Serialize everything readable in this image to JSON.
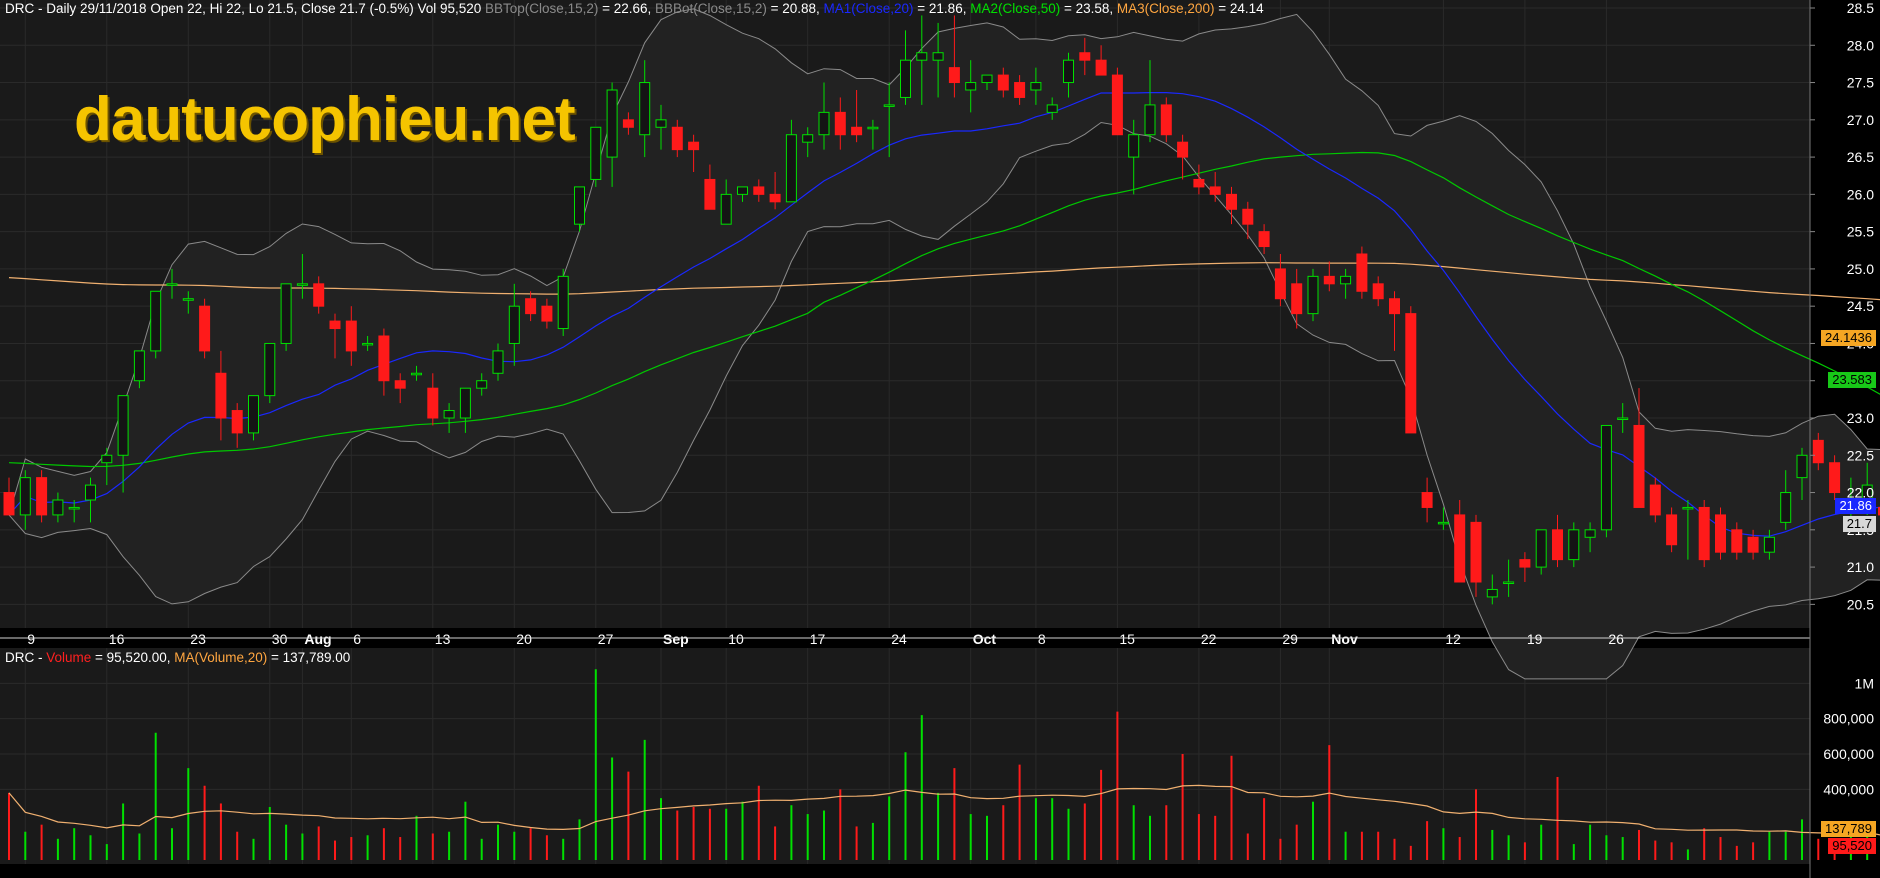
{
  "header": {
    "title": "DRC - Daily 29/11/2018 Open 22, Hi 22, Lo 21.5, Close 21.7 (-0.5%) Vol 95,520 ",
    "bbtop_label": "BBTop(Close,15,2)",
    "bbtop_value": " = 22.66, ",
    "bbbot_label": "BBBot(Close,15,2)",
    "bbbot_value": " = 20.88, ",
    "ma1_label": "MA1(Close,20)",
    "ma1_value": " = 21.86, ",
    "ma2_label": "MA2(Close,50)",
    "ma2_value": " = 23.58, ",
    "ma3_label": "MA3(Close,200)",
    "ma3_value": " = 24.14"
  },
  "volume_header": {
    "prefix": "DRC - ",
    "vol_label": "Volume",
    "vol_value": " = 95,520.00, ",
    "ma_label": "MA(Volume,20)",
    "ma_value": " = 137,789.00"
  },
  "watermark": "dautucophieu.net",
  "price_tags": {
    "ma3": "24.1436",
    "ma2": "23.583",
    "ma1": "21.86",
    "close": "21.7"
  },
  "volume_tags": {
    "ma": "137,789",
    "vol": "95,520"
  },
  "colors": {
    "background": "#000000",
    "up": "#00e000",
    "down": "#ff1a1a",
    "bollinger": "#8a8a8a",
    "ma1": "#1a28ff",
    "ma2": "#00c800",
    "ma3": "#f0b070",
    "grid": "#2a2a2a",
    "band_fill": "#222222"
  },
  "chart_data": {
    "type": "candlestick",
    "ticker": "DRC",
    "price_axis": {
      "min": 20.25,
      "max": 28.5,
      "ticks": [
        "20.5",
        "21.0",
        "21.5",
        "22.0",
        "22.5",
        "23.0",
        "23.5",
        "24.0",
        "24.5",
        "25.0",
        "25.5",
        "26.0",
        "26.5",
        "27.0",
        "27.5",
        "28.0",
        "28.5"
      ]
    },
    "volume_axis": {
      "min": 0,
      "max": 1200000,
      "ticks": [
        "400,000",
        "600,000",
        "800,000",
        "1M"
      ],
      "tick_values": [
        400000,
        600000,
        800000,
        1000000
      ]
    },
    "x_labels": [
      {
        "i": 1,
        "t": "9"
      },
      {
        "i": 6,
        "t": "16"
      },
      {
        "i": 11,
        "t": "23"
      },
      {
        "i": 16,
        "t": "30"
      },
      {
        "i": 18,
        "t": "Aug"
      },
      {
        "i": 21,
        "t": "6"
      },
      {
        "i": 26,
        "t": "13"
      },
      {
        "i": 31,
        "t": "20"
      },
      {
        "i": 36,
        "t": "27"
      },
      {
        "i": 40,
        "t": "Sep"
      },
      {
        "i": 44,
        "t": "10"
      },
      {
        "i": 49,
        "t": "17"
      },
      {
        "i": 54,
        "t": "24"
      },
      {
        "i": 59,
        "t": "Oct"
      },
      {
        "i": 63,
        "t": "8"
      },
      {
        "i": 68,
        "t": "15"
      },
      {
        "i": 73,
        "t": "22"
      },
      {
        "i": 78,
        "t": "29"
      },
      {
        "i": 81,
        "t": "Nov"
      },
      {
        "i": 88,
        "t": "12"
      },
      {
        "i": 93,
        "t": "19"
      },
      {
        "i": 98,
        "t": "26"
      }
    ],
    "ohlc": [
      [
        22.0,
        22.2,
        21.7,
        21.7
      ],
      [
        21.7,
        22.3,
        21.5,
        22.2
      ],
      [
        22.2,
        22.3,
        21.6,
        21.7
      ],
      [
        21.7,
        22.0,
        21.6,
        21.9
      ],
      [
        21.8,
        21.9,
        21.6,
        21.8
      ],
      [
        21.9,
        22.2,
        21.6,
        22.1
      ],
      [
        22.4,
        22.6,
        22.1,
        22.5
      ],
      [
        22.5,
        23.3,
        22.0,
        23.3
      ],
      [
        23.5,
        23.9,
        23.4,
        23.9
      ],
      [
        23.9,
        24.7,
        23.8,
        24.7
      ],
      [
        24.8,
        25.0,
        24.6,
        24.8
      ],
      [
        24.6,
        24.7,
        24.4,
        24.6
      ],
      [
        24.5,
        24.6,
        23.8,
        23.9
      ],
      [
        23.6,
        23.9,
        22.7,
        23.0
      ],
      [
        23.1,
        23.2,
        22.6,
        22.8
      ],
      [
        22.8,
        23.3,
        22.7,
        23.3
      ],
      [
        23.3,
        24.0,
        23.2,
        24.0
      ],
      [
        24.0,
        24.8,
        23.9,
        24.8
      ],
      [
        24.8,
        25.2,
        24.6,
        24.8
      ],
      [
        24.8,
        24.9,
        24.4,
        24.5
      ],
      [
        24.3,
        24.4,
        23.8,
        24.2
      ],
      [
        24.3,
        24.5,
        23.7,
        23.9
      ],
      [
        24.0,
        24.1,
        23.9,
        24.0
      ],
      [
        24.1,
        24.2,
        23.3,
        23.5
      ],
      [
        23.5,
        23.6,
        23.2,
        23.4
      ],
      [
        23.6,
        23.7,
        23.5,
        23.6
      ],
      [
        23.4,
        23.6,
        22.9,
        23.0
      ],
      [
        23.0,
        23.2,
        22.8,
        23.1
      ],
      [
        23.0,
        23.4,
        22.8,
        23.4
      ],
      [
        23.4,
        23.6,
        23.3,
        23.5
      ],
      [
        23.6,
        24.0,
        23.5,
        23.9
      ],
      [
        24.0,
        24.8,
        23.7,
        24.5
      ],
      [
        24.6,
        24.7,
        24.3,
        24.4
      ],
      [
        24.5,
        24.6,
        24.2,
        24.3
      ],
      [
        24.2,
        25.0,
        24.1,
        24.9
      ],
      [
        25.6,
        26.1,
        25.5,
        26.1
      ],
      [
        26.2,
        26.9,
        26.1,
        26.9
      ],
      [
        26.5,
        27.5,
        26.1,
        27.4
      ],
      [
        27.0,
        27.1,
        26.8,
        26.9
      ],
      [
        26.8,
        27.8,
        26.5,
        27.5
      ],
      [
        26.9,
        27.2,
        26.6,
        27.0
      ],
      [
        26.9,
        27.0,
        26.5,
        26.6
      ],
      [
        26.7,
        26.8,
        26.3,
        26.6
      ],
      [
        26.2,
        26.4,
        25.8,
        25.8
      ],
      [
        25.6,
        26.2,
        25.6,
        26.0
      ],
      [
        26.0,
        26.1,
        25.9,
        26.1
      ],
      [
        26.1,
        26.2,
        25.9,
        26.0
      ],
      [
        26.0,
        26.3,
        25.8,
        25.9
      ],
      [
        25.9,
        27.0,
        25.9,
        26.8
      ],
      [
        26.7,
        26.9,
        26.5,
        26.8
      ],
      [
        26.8,
        27.5,
        26.6,
        27.1
      ],
      [
        27.1,
        27.3,
        26.6,
        26.8
      ],
      [
        26.9,
        27.4,
        26.7,
        26.8
      ],
      [
        26.9,
        27.0,
        26.6,
        26.9
      ],
      [
        27.2,
        27.5,
        26.5,
        27.2
      ],
      [
        27.3,
        28.2,
        27.2,
        27.8
      ],
      [
        27.8,
        28.4,
        27.2,
        27.9
      ],
      [
        27.8,
        28.3,
        27.3,
        27.9
      ],
      [
        27.7,
        28.4,
        27.3,
        27.5
      ],
      [
        27.4,
        27.8,
        27.1,
        27.5
      ],
      [
        27.5,
        27.6,
        27.4,
        27.6
      ],
      [
        27.6,
        27.7,
        27.3,
        27.4
      ],
      [
        27.5,
        27.6,
        27.2,
        27.3
      ],
      [
        27.4,
        27.7,
        27.2,
        27.5
      ],
      [
        27.1,
        27.3,
        27.0,
        27.2
      ],
      [
        27.5,
        27.9,
        27.3,
        27.8
      ],
      [
        27.9,
        28.1,
        27.6,
        27.8
      ],
      [
        27.8,
        28.0,
        27.6,
        27.6
      ],
      [
        27.6,
        27.7,
        26.8,
        26.8
      ],
      [
        26.5,
        27.0,
        26.0,
        26.8
      ],
      [
        26.8,
        27.8,
        26.7,
        27.2
      ],
      [
        27.2,
        27.3,
        26.7,
        26.8
      ],
      [
        26.7,
        26.8,
        26.2,
        26.5
      ],
      [
        26.2,
        26.4,
        26.0,
        26.1
      ],
      [
        26.1,
        26.3,
        25.9,
        26.0
      ],
      [
        26.0,
        26.1,
        25.6,
        25.8
      ],
      [
        25.8,
        25.9,
        25.4,
        25.6
      ],
      [
        25.5,
        25.6,
        25.2,
        25.3
      ],
      [
        25.0,
        25.2,
        24.5,
        24.6
      ],
      [
        24.8,
        25.0,
        24.2,
        24.4
      ],
      [
        24.4,
        25.0,
        24.3,
        24.9
      ],
      [
        24.9,
        25.1,
        24.7,
        24.8
      ],
      [
        24.8,
        25.0,
        24.6,
        24.9
      ],
      [
        25.2,
        25.3,
        24.6,
        24.7
      ],
      [
        24.8,
        24.9,
        24.5,
        24.6
      ],
      [
        24.6,
        24.7,
        23.9,
        24.4
      ],
      [
        24.4,
        24.5,
        22.8,
        22.8
      ],
      [
        22.0,
        22.2,
        21.6,
        21.8
      ],
      [
        21.6,
        21.8,
        21.5,
        21.6
      ],
      [
        21.7,
        21.9,
        20.8,
        20.8
      ],
      [
        21.6,
        21.7,
        20.6,
        20.8
      ],
      [
        20.6,
        20.9,
        20.5,
        20.7
      ],
      [
        20.8,
        21.1,
        20.6,
        20.8
      ],
      [
        21.1,
        21.2,
        20.8,
        21.0
      ],
      [
        21.0,
        21.5,
        20.9,
        21.5
      ],
      [
        21.5,
        21.7,
        21.0,
        21.1
      ],
      [
        21.1,
        21.6,
        21.0,
        21.5
      ],
      [
        21.4,
        21.6,
        21.2,
        21.5
      ],
      [
        21.5,
        22.9,
        21.4,
        22.9
      ],
      [
        23.0,
        23.2,
        22.8,
        23.0
      ],
      [
        22.9,
        23.4,
        22.0,
        21.8
      ],
      [
        22.1,
        22.2,
        21.6,
        21.7
      ],
      [
        21.7,
        21.8,
        21.2,
        21.3
      ],
      [
        21.8,
        21.9,
        21.1,
        21.8
      ],
      [
        21.8,
        21.9,
        21.0,
        21.1
      ],
      [
        21.7,
        21.8,
        21.1,
        21.2
      ],
      [
        21.5,
        21.6,
        21.1,
        21.2
      ],
      [
        21.4,
        21.5,
        21.1,
        21.2
      ],
      [
        21.2,
        21.5,
        21.1,
        21.4
      ],
      [
        21.6,
        22.3,
        21.5,
        22.0
      ],
      [
        22.2,
        22.6,
        21.9,
        22.5
      ],
      [
        22.7,
        22.8,
        22.3,
        22.4
      ],
      [
        22.4,
        22.5,
        21.9,
        22.0
      ],
      [
        21.8,
        22.2,
        21.5,
        21.9
      ],
      [
        21.9,
        22.4,
        21.7,
        22.1
      ],
      [
        21.8,
        21.9,
        21.5,
        21.7
      ],
      [
        22.0,
        22.0,
        21.5,
        21.7
      ]
    ],
    "volume": [
      380000,
      160000,
      200000,
      120000,
      180000,
      140000,
      90000,
      320000,
      150000,
      720000,
      180000,
      520000,
      420000,
      320000,
      160000,
      120000,
      300000,
      200000,
      150000,
      190000,
      110000,
      130000,
      140000,
      180000,
      130000,
      250000,
      150000,
      160000,
      330000,
      120000,
      200000,
      160000,
      180000,
      140000,
      120000,
      230000,
      1080000,
      580000,
      500000,
      680000,
      350000,
      280000,
      300000,
      290000,
      290000,
      330000,
      420000,
      190000,
      310000,
      260000,
      280000,
      400000,
      190000,
      210000,
      360000,
      610000,
      820000,
      380000,
      520000,
      260000,
      250000,
      310000,
      540000,
      350000,
      350000,
      290000,
      320000,
      510000,
      840000,
      310000,
      250000,
      310000,
      600000,
      260000,
      250000,
      590000,
      150000,
      350000,
      120000,
      200000,
      330000,
      650000,
      160000,
      160000,
      160000,
      120000,
      80000,
      220000,
      180000,
      130000,
      400000,
      170000,
      140000,
      100000,
      200000,
      470000,
      90000,
      200000,
      140000,
      130000,
      170000,
      110000,
      100000,
      60000,
      180000,
      130000,
      80000,
      100000,
      160000,
      160000,
      230000,
      120000,
      100000,
      200000,
      200000,
      100000,
      95520
    ],
    "ma1": {
      "name": "MA1(Close,20)",
      "last": 21.86
    },
    "ma2": {
      "name": "MA2(Close,50)",
      "last": 23.58
    },
    "ma3": {
      "name": "MA3(Close,200)",
      "last": 24.14
    },
    "bb_top": {
      "name": "BBTop(Close,15,2)",
      "last": 22.66
    },
    "bb_bot": {
      "name": "BBBot(Close,15,2)",
      "last": 20.88
    },
    "volume_ma": {
      "name": "MA(Volume,20)",
      "last": 137789
    },
    "last_volume": 95520
  }
}
